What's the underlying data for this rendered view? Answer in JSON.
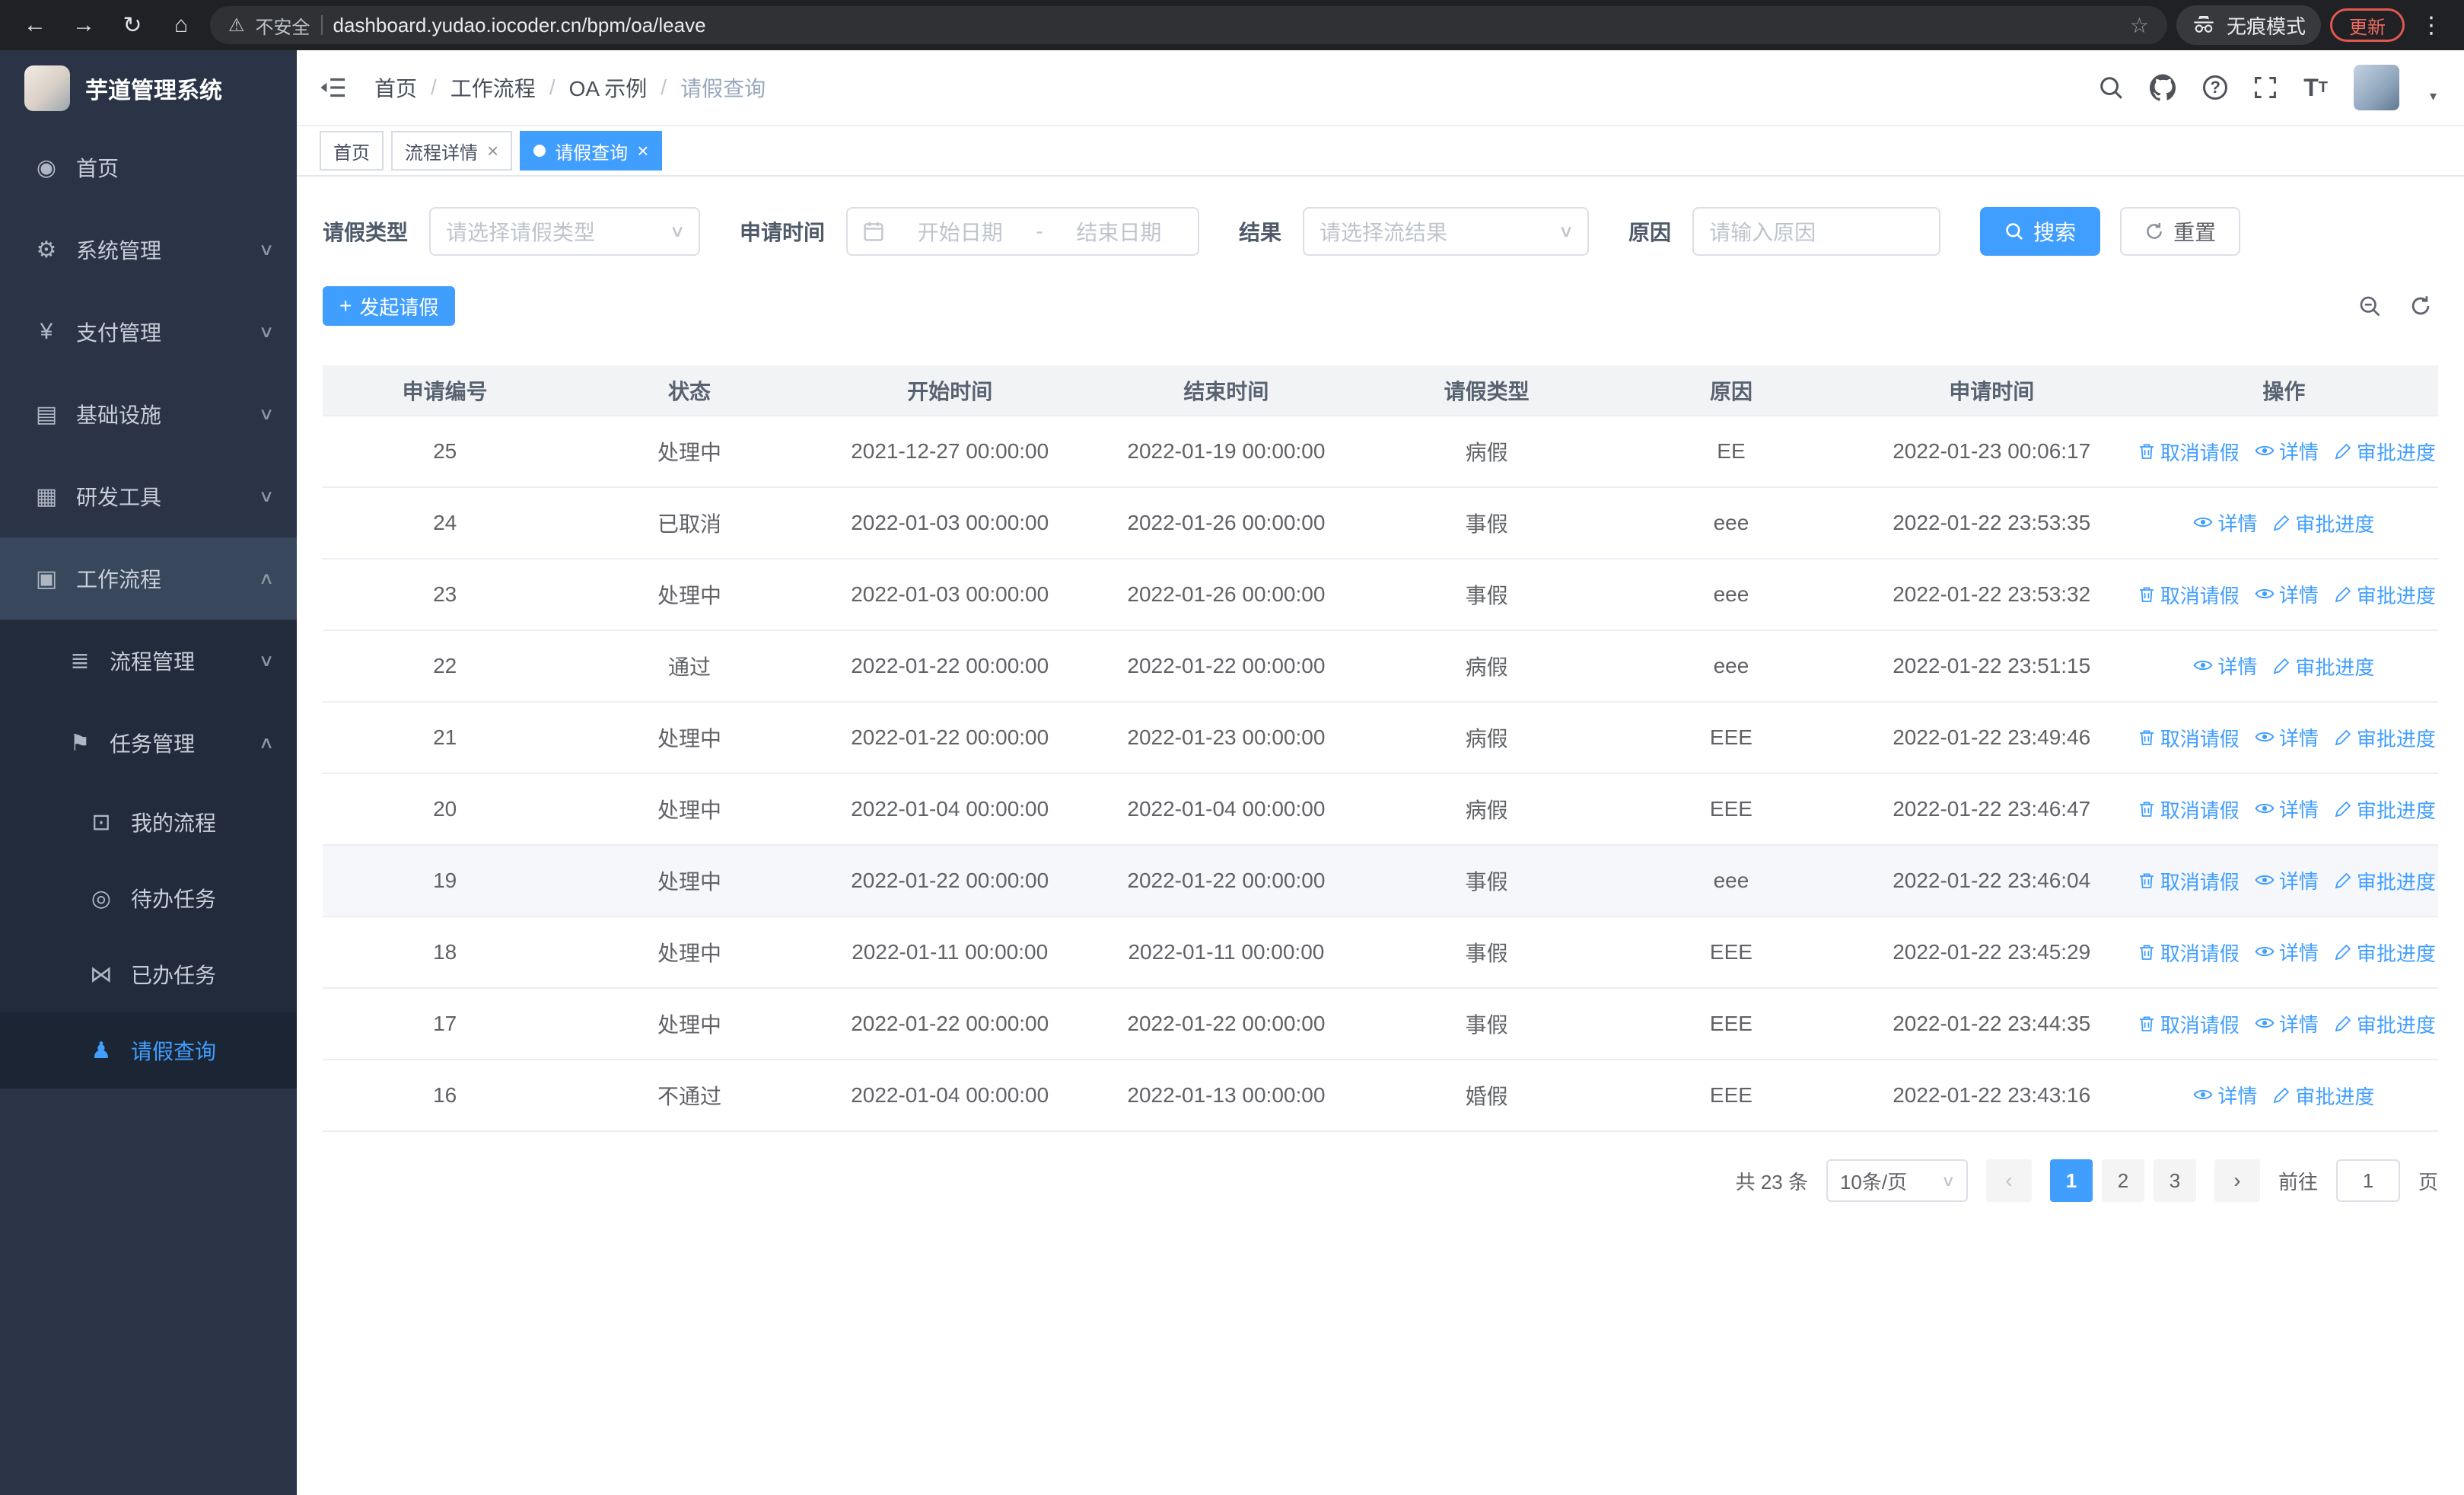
{
  "colors": {
    "primary": "#409eff",
    "sidebar_bg": "#2a3446",
    "sidebar_sub_bg": "#212b3b"
  },
  "browser": {
    "security_label": "不安全",
    "url": "dashboard.yudao.iocoder.cn/bpm/oa/leave",
    "incognito_label": "无痕模式",
    "update_label": "更新"
  },
  "sidebar": {
    "logo_title": "芋道管理系统",
    "items": [
      {
        "name": "home",
        "icon": "dashboard-icon",
        "glyph": "◉",
        "label": "首页",
        "level": 1
      },
      {
        "name": "system-management",
        "icon": "gear-icon",
        "glyph": "⚙",
        "label": "系统管理",
        "level": 1,
        "arrow": "down"
      },
      {
        "name": "payment-management",
        "icon": "yen-icon",
        "glyph": "¥",
        "label": "支付管理",
        "level": 1,
        "arrow": "down"
      },
      {
        "name": "infrastructure",
        "icon": "server-icon",
        "glyph": "▤",
        "label": "基础设施",
        "level": 1,
        "arrow": "down"
      },
      {
        "name": "dev-tools",
        "icon": "tools-icon",
        "glyph": "▦",
        "label": "研发工具",
        "level": 1,
        "arrow": "down"
      },
      {
        "name": "workflow",
        "icon": "briefcase-icon",
        "glyph": "▣",
        "label": "工作流程",
        "level": 1,
        "arrow": "up",
        "open": true
      },
      {
        "name": "process-management",
        "icon": "list-icon",
        "glyph": "≣",
        "label": "流程管理",
        "level": 2,
        "arrow": "down",
        "sub": true
      },
      {
        "name": "task-management",
        "icon": "flag-icon",
        "glyph": "⚑",
        "label": "任务管理",
        "level": 2,
        "arrow": "up",
        "sub": true
      },
      {
        "name": "my-processes",
        "icon": "chat-icon",
        "glyph": "⊡",
        "label": "我的流程",
        "level": 3,
        "sub": true
      },
      {
        "name": "todo-tasks",
        "icon": "eye-icon",
        "glyph": "◎",
        "label": "待办任务",
        "level": 3,
        "sub": true
      },
      {
        "name": "done-tasks",
        "icon": "bowtie-icon",
        "glyph": "⋈",
        "label": "已办任务",
        "level": 3,
        "sub": true
      },
      {
        "name": "leave-query",
        "icon": "person-icon",
        "glyph": "♟",
        "label": "请假查询",
        "level": 3,
        "sub": true,
        "active": true
      }
    ]
  },
  "header": {
    "breadcrumb": [
      "首页",
      "工作流程",
      "OA 示例",
      "请假查询"
    ],
    "icon_names": [
      "search-icon",
      "github-icon",
      "help-icon",
      "fullscreen-icon",
      "font-size-icon"
    ]
  },
  "tabs": [
    {
      "name": "home",
      "label": "首页"
    },
    {
      "name": "flow-detail",
      "label": "流程详情",
      "closable": true
    },
    {
      "name": "leave-query",
      "label": "请假查询",
      "closable": true,
      "active": true
    }
  ],
  "filters": {
    "leave_type": {
      "label": "请假类型",
      "placeholder": "请选择请假类型"
    },
    "apply_time": {
      "label": "申请时间",
      "start_placeholder": "开始日期",
      "separator": "-",
      "end_placeholder": "结束日期"
    },
    "result": {
      "label": "结果",
      "placeholder": "请选择流结果"
    },
    "reason": {
      "label": "原因",
      "placeholder": "请输入原因"
    },
    "search_label": "搜索",
    "reset_label": "重置"
  },
  "toolbar": {
    "create_label": "发起请假"
  },
  "table": {
    "columns": [
      "申请编号",
      "状态",
      "开始时间",
      "结束时间",
      "请假类型",
      "原因",
      "申请时间",
      "操作"
    ],
    "action_labels": {
      "cancel": "取消请假",
      "detail": "详情",
      "progress": "审批进度"
    },
    "rows": [
      {
        "id": "25",
        "status": "处理中",
        "start_time": "2021-12-27 00:00:00",
        "end_time": "2022-01-19 00:00:00",
        "leave_type": "病假",
        "reason": "EE",
        "apply_time": "2022-01-23 00:06:17",
        "actions": [
          "cancel",
          "detail",
          "progress"
        ]
      },
      {
        "id": "24",
        "status": "已取消",
        "start_time": "2022-01-03 00:00:00",
        "end_time": "2022-01-26 00:00:00",
        "leave_type": "事假",
        "reason": "eee",
        "apply_time": "2022-01-22 23:53:35",
        "actions": [
          "detail",
          "progress"
        ]
      },
      {
        "id": "23",
        "status": "处理中",
        "start_time": "2022-01-03 00:00:00",
        "end_time": "2022-01-26 00:00:00",
        "leave_type": "事假",
        "reason": "eee",
        "apply_time": "2022-01-22 23:53:32",
        "actions": [
          "cancel",
          "detail",
          "progress"
        ]
      },
      {
        "id": "22",
        "status": "通过",
        "start_time": "2022-01-22 00:00:00",
        "end_time": "2022-01-22 00:00:00",
        "leave_type": "病假",
        "reason": "eee",
        "apply_time": "2022-01-22 23:51:15",
        "actions": [
          "detail",
          "progress"
        ]
      },
      {
        "id": "21",
        "status": "处理中",
        "start_time": "2022-01-22 00:00:00",
        "end_time": "2022-01-23 00:00:00",
        "leave_type": "病假",
        "reason": "EEE",
        "apply_time": "2022-01-22 23:49:46",
        "actions": [
          "cancel",
          "detail",
          "progress"
        ]
      },
      {
        "id": "20",
        "status": "处理中",
        "start_time": "2022-01-04 00:00:00",
        "end_time": "2022-01-04 00:00:00",
        "leave_type": "病假",
        "reason": "EEE",
        "apply_time": "2022-01-22 23:46:47",
        "actions": [
          "cancel",
          "detail",
          "progress"
        ]
      },
      {
        "id": "19",
        "status": "处理中",
        "start_time": "2022-01-22 00:00:00",
        "end_time": "2022-01-22 00:00:00",
        "leave_type": "事假",
        "reason": "eee",
        "apply_time": "2022-01-22 23:46:04",
        "actions": [
          "cancel",
          "detail",
          "progress"
        ],
        "hover": true
      },
      {
        "id": "18",
        "status": "处理中",
        "start_time": "2022-01-11 00:00:00",
        "end_time": "2022-01-11 00:00:00",
        "leave_type": "事假",
        "reason": "EEE",
        "apply_time": "2022-01-22 23:45:29",
        "actions": [
          "cancel",
          "detail",
          "progress"
        ]
      },
      {
        "id": "17",
        "status": "处理中",
        "start_time": "2022-01-22 00:00:00",
        "end_time": "2022-01-22 00:00:00",
        "leave_type": "事假",
        "reason": "EEE",
        "apply_time": "2022-01-22 23:44:35",
        "actions": [
          "cancel",
          "detail",
          "progress"
        ]
      },
      {
        "id": "16",
        "status": "不通过",
        "start_time": "2022-01-04 00:00:00",
        "end_time": "2022-01-13 00:00:00",
        "leave_type": "婚假",
        "reason": "EEE",
        "apply_time": "2022-01-22 23:43:16",
        "actions": [
          "detail",
          "progress"
        ]
      }
    ]
  },
  "pagination": {
    "total_label": "共 23 条",
    "page_size": "10条/页",
    "pages": [
      "1",
      "2",
      "3"
    ],
    "active_page": "1",
    "goto_label": "前往",
    "goto_value": "1",
    "goto_unit": "页"
  }
}
